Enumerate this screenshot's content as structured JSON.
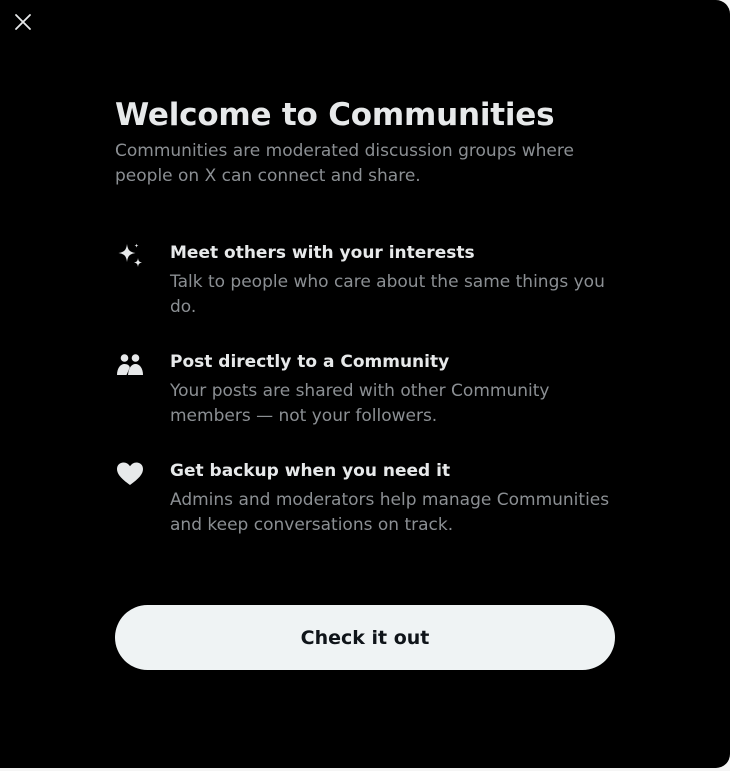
{
  "modal": {
    "title": "Welcome to Communities",
    "subtitle": "Communities are moderated discussion groups where people on X can connect and share.",
    "features": [
      {
        "icon": "sparkle-icon",
        "title": "Meet others with your interests",
        "description": "Talk to people who care about the same things you do."
      },
      {
        "icon": "people-icon",
        "title": "Post directly to a Community",
        "description": "Your posts are shared with other Community members — not your followers."
      },
      {
        "icon": "heart-icon",
        "title": "Get backup when you need it",
        "description": "Admins and moderators help manage Communities and keep conversations on track."
      }
    ],
    "cta_label": "Check it out",
    "close_icon": "close-icon"
  },
  "colors": {
    "background": "#000000",
    "heading": "#e7e9ea",
    "muted_text": "#8b8f93",
    "button_bg": "#eff3f4",
    "button_text": "#0f1419"
  }
}
